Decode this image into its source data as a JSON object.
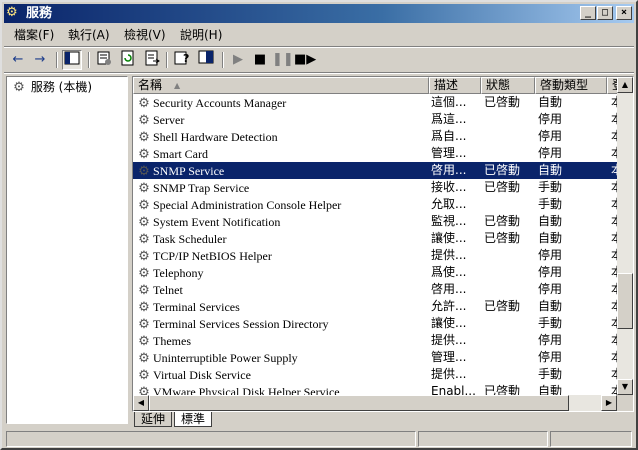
{
  "window": {
    "title": "服務",
    "title_icon": "services-gear-icon"
  },
  "menu": [
    {
      "label": "檔案(F)"
    },
    {
      "label": "執行(A)"
    },
    {
      "label": "檢視(V)"
    },
    {
      "label": "說明(H)"
    }
  ],
  "toolbar": {
    "back_icon": "←",
    "forward_icon": "→"
  },
  "tree": {
    "root_label": "服務 (本機)"
  },
  "columns": [
    {
      "label": "名稱"
    },
    {
      "label": "描述"
    },
    {
      "label": "狀態"
    },
    {
      "label": "啓動類型"
    },
    {
      "label": "登"
    }
  ],
  "sort_indicator": "▲",
  "services": [
    {
      "name": "Security Accounts Manager",
      "desc": "這個...",
      "status": "已啓動",
      "startup": "自動",
      "logon": "本"
    },
    {
      "name": "Server",
      "desc": "爲這...",
      "status": "",
      "startup": "停用",
      "logon": "本"
    },
    {
      "name": "Shell Hardware Detection",
      "desc": "爲自...",
      "status": "",
      "startup": "停用",
      "logon": "本"
    },
    {
      "name": "Smart Card",
      "desc": "管理...",
      "status": "",
      "startup": "停用",
      "logon": "本"
    },
    {
      "name": "SNMP Service",
      "desc": "啓用...",
      "status": "已啓動",
      "startup": "自動",
      "logon": "本"
    },
    {
      "name": "SNMP Trap Service",
      "desc": "接收...",
      "status": "已啓動",
      "startup": "手動",
      "logon": "本"
    },
    {
      "name": "Special Administration Console Helper",
      "desc": "允取...",
      "status": "",
      "startup": "手動",
      "logon": "本"
    },
    {
      "name": "System Event Notification",
      "desc": "監視...",
      "status": "已啓動",
      "startup": "自動",
      "logon": "本"
    },
    {
      "name": "Task Scheduler",
      "desc": "讓使...",
      "status": "已啓動",
      "startup": "自動",
      "logon": "本"
    },
    {
      "name": "TCP/IP NetBIOS Helper",
      "desc": "提供...",
      "status": "",
      "startup": "停用",
      "logon": "本"
    },
    {
      "name": "Telephony",
      "desc": "爲使...",
      "status": "",
      "startup": "停用",
      "logon": "本"
    },
    {
      "name": "Telnet",
      "desc": "啓用...",
      "status": "",
      "startup": "停用",
      "logon": "本"
    },
    {
      "name": "Terminal Services",
      "desc": "允許...",
      "status": "已啓動",
      "startup": "自動",
      "logon": "本"
    },
    {
      "name": "Terminal Services Session Directory",
      "desc": "讓使...",
      "status": "",
      "startup": "手動",
      "logon": "本"
    },
    {
      "name": "Themes",
      "desc": "提供...",
      "status": "",
      "startup": "停用",
      "logon": "本"
    },
    {
      "name": "Uninterruptible Power Supply",
      "desc": "管理...",
      "status": "",
      "startup": "停用",
      "logon": "本"
    },
    {
      "name": "Virtual Disk Service",
      "desc": "提供...",
      "status": "",
      "startup": "手動",
      "logon": "本"
    },
    {
      "name": "VMware Physical Disk Helper Service",
      "desc": "Enabl...",
      "status": "已啓動",
      "startup": "自動",
      "logon": "本"
    }
  ],
  "selected_service": "SNMP Service",
  "tabs": [
    {
      "label": "延伸"
    },
    {
      "label": "標準",
      "active": true
    }
  ],
  "colors": {
    "title_start": "#0a246a",
    "title_end": "#a6caf0",
    "selection": "#0a246a",
    "face": "#d4d0c8"
  }
}
